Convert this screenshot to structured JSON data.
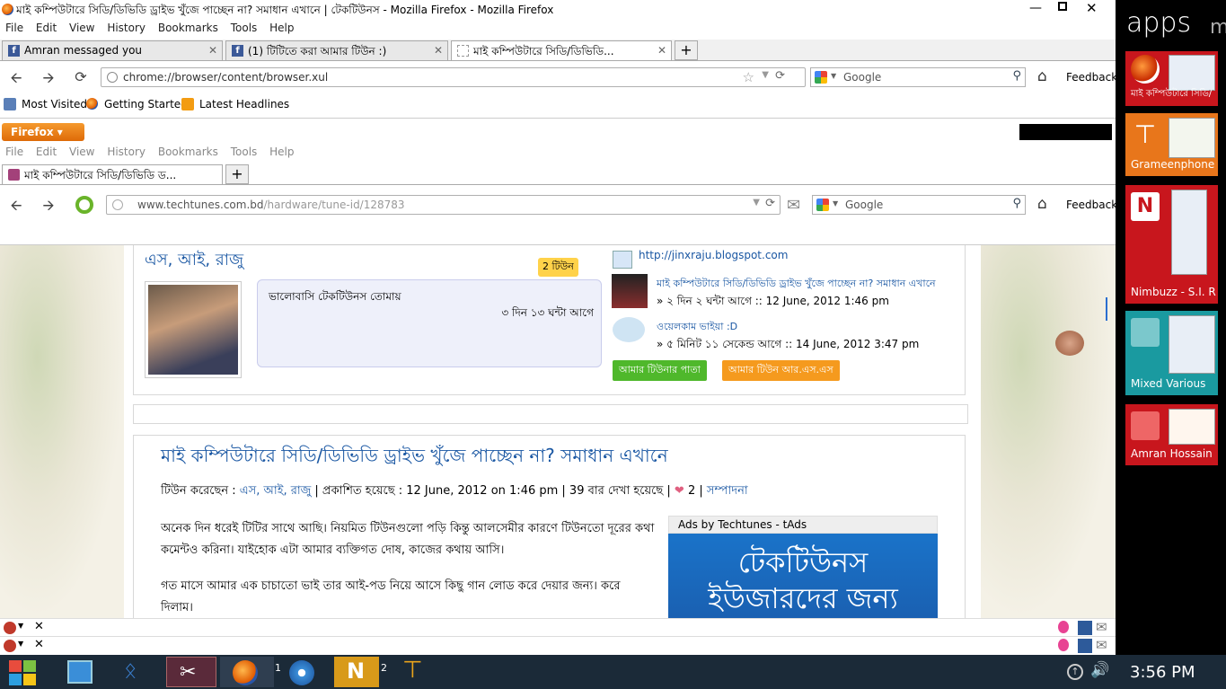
{
  "window": {
    "title": "মাই কম্পিউটারে সিডি/ডিভিডি ড্রাইভ খুঁজে পাচ্ছেন না? সমাধান এখানে | টেকটিউনস - Mozilla Firefox - Mozilla Firefox"
  },
  "outer": {
    "menu": [
      "File",
      "Edit",
      "View",
      "History",
      "Bookmarks",
      "Tools",
      "Help"
    ],
    "tabs": [
      {
        "label": "Amran messaged you"
      },
      {
        "label": "(1) টিটিতে করা আমার টিউন :)"
      },
      {
        "label": "মাই কম্পিউটারে সিডি/ডিভিডি..."
      }
    ],
    "url": "chrome://browser/content/browser.xul",
    "search_placeholder": "Google",
    "feedback": "Feedback",
    "bookmarks": [
      "Most Visited",
      "Getting Started",
      "Latest Headlines"
    ]
  },
  "inner": {
    "firefox_button": "Firefox",
    "menu": [
      "File",
      "Edit",
      "View",
      "History",
      "Bookmarks",
      "Tools",
      "Help"
    ],
    "tab": "মাই কম্পিউটারে সিডি/ডিভিডি ড...",
    "url_host": "www.techtunes.com.bd",
    "url_path": "/hardware/tune-id/128783",
    "search_placeholder": "Google",
    "feedback": "Feedback"
  },
  "author": {
    "name": "এস, আই, রাজু",
    "tune_count": "2 টিউন",
    "quote": "ভালোবাসি টেকটিউনস তোমায়",
    "quote_time": "৩ দিন ১৩ ঘন্টা আগে",
    "website": "http://jinxraju.blogspot.com",
    "recent1_title": "মাই কম্পিউটারে সিডি/ডিভিডি ড্রাইভ খুঁজে পাচ্ছেন না? সমাধান এখানে",
    "recent1_meta": "» ২ দিন ২ ঘন্টা আগে :: 12 June, 2012 1:46 pm",
    "recent2_title": "ওয়েলকাম ভাইয়া :D",
    "recent2_meta": "» ৫ মিনিট ১১ সেকেন্ড আগে :: 14 June, 2012 3:47 pm",
    "btn_page": "আমার টিউনার পাতা",
    "btn_rss": "আমার টিউন আর.এস.এস"
  },
  "article": {
    "title": "মাই কম্পিউটারে সিডি/ডিভিডি ড্রাইভ খুঁজে পাচ্ছেন না? সমাধান এখানে",
    "meta_prefix": "টিউন করেছেন : ",
    "meta_author": "এস, আই, রাজু",
    "meta_rest": " | প্রকাশিত হয়েছে : 12 June, 2012 on 1:46 pm | 39 বার দেখা হয়েছে | ",
    "likes": "2",
    "edit": "সম্পাদনা",
    "para1": "অনেক দিন ধরেই টিটির সাথে আছি। নিয়মিত টিউনগুলো পড়ি কিন্তু আলসেমীর কারণে টিউনতো দূরের কথা কমেন্টও করিনা। যাইহোক এটা আমার ব্যক্তিগত দোষ, কাজের কথায় আসি।",
    "para2": "গত মাসে আমার এক চাচাতো ভাই তার আই-পড নিয়ে আসে কিছু গান লোড করে দেয়ার জন্য। করে দিলাম।",
    "ads_label": "Ads by Techtunes - tAds",
    "ad_line1": "টেকটিউনস",
    "ad_line2": "ইউজারদের জন্য"
  },
  "apps_panel": {
    "heading": "apps",
    "heading_cut": "m",
    "tiles": [
      {
        "label": "মাই কম্পিউটারে সিডি/"
      },
      {
        "label": "Grameenphone"
      },
      {
        "label": "Nimbuzz - S.I. R"
      },
      {
        "label": "Mixed Various"
      },
      {
        "label": "Amran Hossain"
      }
    ]
  },
  "taskbar": {
    "clock": "3:56 PM",
    "badge1": "1",
    "badge2": "2"
  },
  "colors": {
    "tile_red": "#c8161d",
    "tile_orange": "#e8761b",
    "tile_teal": "#1a9aa0",
    "taskbar": "#1b2a38"
  }
}
